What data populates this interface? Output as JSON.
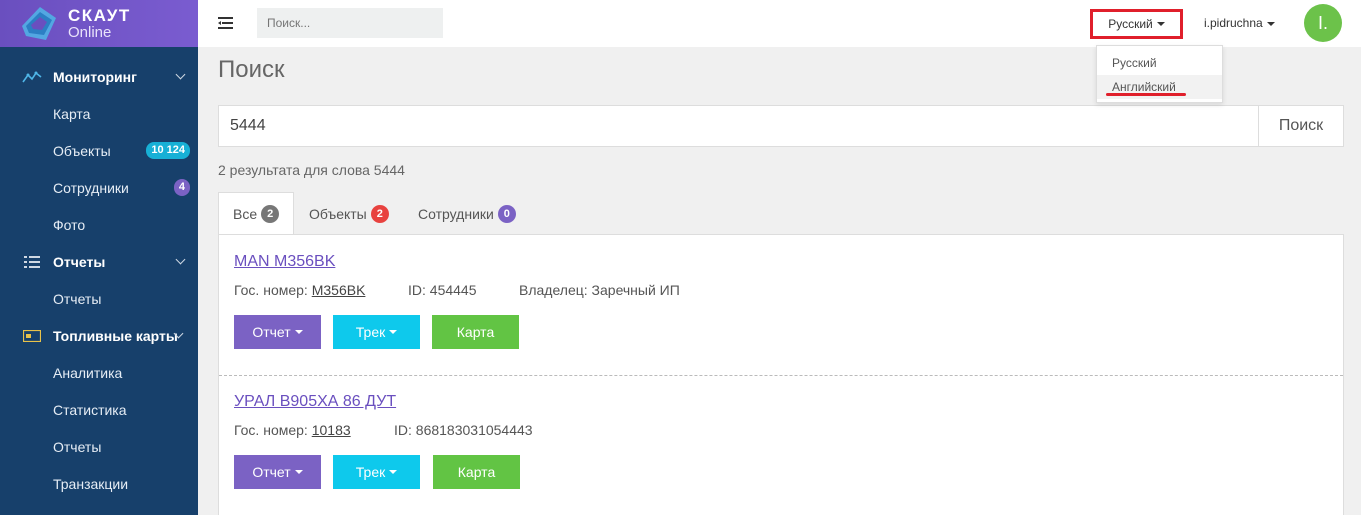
{
  "brand": {
    "name": "СКАУТ",
    "sub": "Online"
  },
  "sidebar": {
    "sections": [
      {
        "label": "Мониторинг",
        "icon": "monitoring-icon",
        "items": [
          {
            "label": "Карта"
          },
          {
            "label": "Объекты",
            "badge": "10 124"
          },
          {
            "label": "Сотрудники",
            "badge": "4"
          },
          {
            "label": "Фото"
          }
        ]
      },
      {
        "label": "Отчеты",
        "icon": "list-icon",
        "items": [
          {
            "label": "Отчеты"
          }
        ]
      },
      {
        "label": "Топливные карты",
        "icon": "fuel-card-icon",
        "items": [
          {
            "label": "Аналитика"
          },
          {
            "label": "Статистика"
          },
          {
            "label": "Отчеты"
          },
          {
            "label": "Транзакции"
          }
        ]
      }
    ]
  },
  "topbar": {
    "search_placeholder": "Поиск...",
    "language": "Русский",
    "user": "i.pidruchna",
    "avatar": "I."
  },
  "language_menu": {
    "options": [
      "Русский",
      "Английский"
    ],
    "highlighted": "Английский"
  },
  "main": {
    "title": "Поиск",
    "query": "5444",
    "search_button": "Поиск",
    "result_count": "2 результата для слова 5444",
    "tabs": [
      {
        "label": "Все",
        "count": "2"
      },
      {
        "label": "Объекты",
        "count": "2"
      },
      {
        "label": "Сотрудники",
        "count": "0"
      }
    ],
    "results": [
      {
        "title": "MAN M356BK",
        "plate_label": "Гос. номер:",
        "plate": "M356BK",
        "id": "ID: 454445",
        "owner": "Владелец: Заречный ИП"
      },
      {
        "title": "УРАЛ В905ХА 86 ДУТ",
        "plate_label": "Гос. номер:",
        "plate": "10183",
        "id": "ID: 868183031054443"
      }
    ],
    "buttons": {
      "report": "Отчет",
      "track": "Трек",
      "map": "Карта"
    }
  },
  "colors": {
    "sidebar": "#17406b",
    "brand": "#6a4fbf",
    "report_btn": "#7b62c4",
    "track_btn": "#0ec9ec",
    "map_btn": "#62c444",
    "highlight": "#e01f2b"
  }
}
